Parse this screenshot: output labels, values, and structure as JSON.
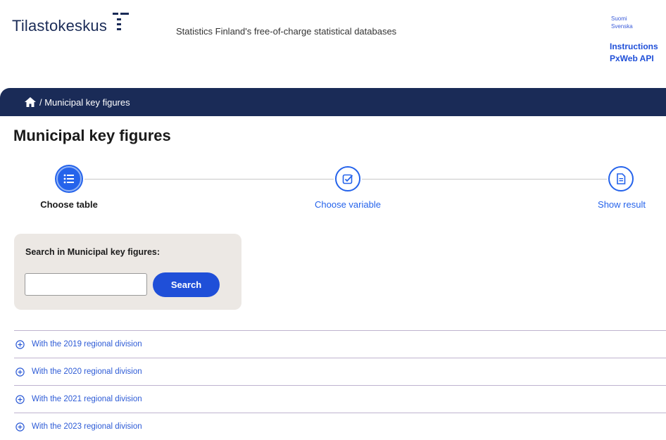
{
  "header": {
    "logo_text": "Tilastokeskus",
    "tagline": "Statistics Finland's free-of-charge statistical databases",
    "languages": [
      "Suomi",
      "Svenska"
    ],
    "links": [
      "Instructions",
      "PxWeb API"
    ]
  },
  "breadcrumb": {
    "current": "/ Municipal key figures"
  },
  "page": {
    "title": "Municipal key figures"
  },
  "stepper": {
    "steps": [
      {
        "label": "Choose table",
        "state": "active"
      },
      {
        "label": "Choose variable",
        "state": "link"
      },
      {
        "label": "Show result",
        "state": "link"
      }
    ]
  },
  "search": {
    "label": "Search in Municipal key figures:",
    "value": "",
    "button": "Search"
  },
  "accordion": {
    "items": [
      {
        "label": "With the 2019 regional division"
      },
      {
        "label": "With the 2020 regional division"
      },
      {
        "label": "With the 2021 regional division"
      },
      {
        "label": "With the 2023 regional division"
      }
    ]
  },
  "colors": {
    "brand_navy": "#1a2b57",
    "accent_blue": "#1f4fd8",
    "search_bg": "#ece8e4"
  }
}
